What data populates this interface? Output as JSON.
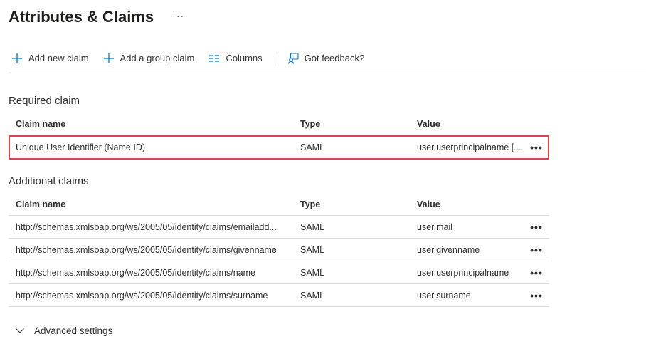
{
  "header": {
    "title": "Attributes & Claims",
    "more": "···"
  },
  "toolbar": {
    "add_new_claim": "Add new claim",
    "add_group_claim": "Add a group claim",
    "columns": "Columns",
    "feedback": "Got feedback?"
  },
  "required": {
    "section_title": "Required claim",
    "columns": {
      "name": "Claim name",
      "type": "Type",
      "value": "Value"
    },
    "rows": [
      {
        "name": "Unique User Identifier (Name ID)",
        "type": "SAML",
        "value": "user.userprincipalname [..."
      }
    ]
  },
  "additional": {
    "section_title": "Additional claims",
    "columns": {
      "name": "Claim name",
      "type": "Type",
      "value": "Value"
    },
    "rows": [
      {
        "name": "http://schemas.xmlsoap.org/ws/2005/05/identity/claims/emailadd...",
        "type": "SAML",
        "value": "user.mail"
      },
      {
        "name": "http://schemas.xmlsoap.org/ws/2005/05/identity/claims/givenname",
        "type": "SAML",
        "value": "user.givenname"
      },
      {
        "name": "http://schemas.xmlsoap.org/ws/2005/05/identity/claims/name",
        "type": "SAML",
        "value": "user.userprincipalname"
      },
      {
        "name": "http://schemas.xmlsoap.org/ws/2005/05/identity/claims/surname",
        "type": "SAML",
        "value": "user.surname"
      }
    ]
  },
  "row_more": "•••",
  "advanced": {
    "label": "Advanced settings"
  },
  "colors": {
    "accent": "#0078d4",
    "highlight": "#e0434b",
    "divider": "#e1dfdd"
  }
}
